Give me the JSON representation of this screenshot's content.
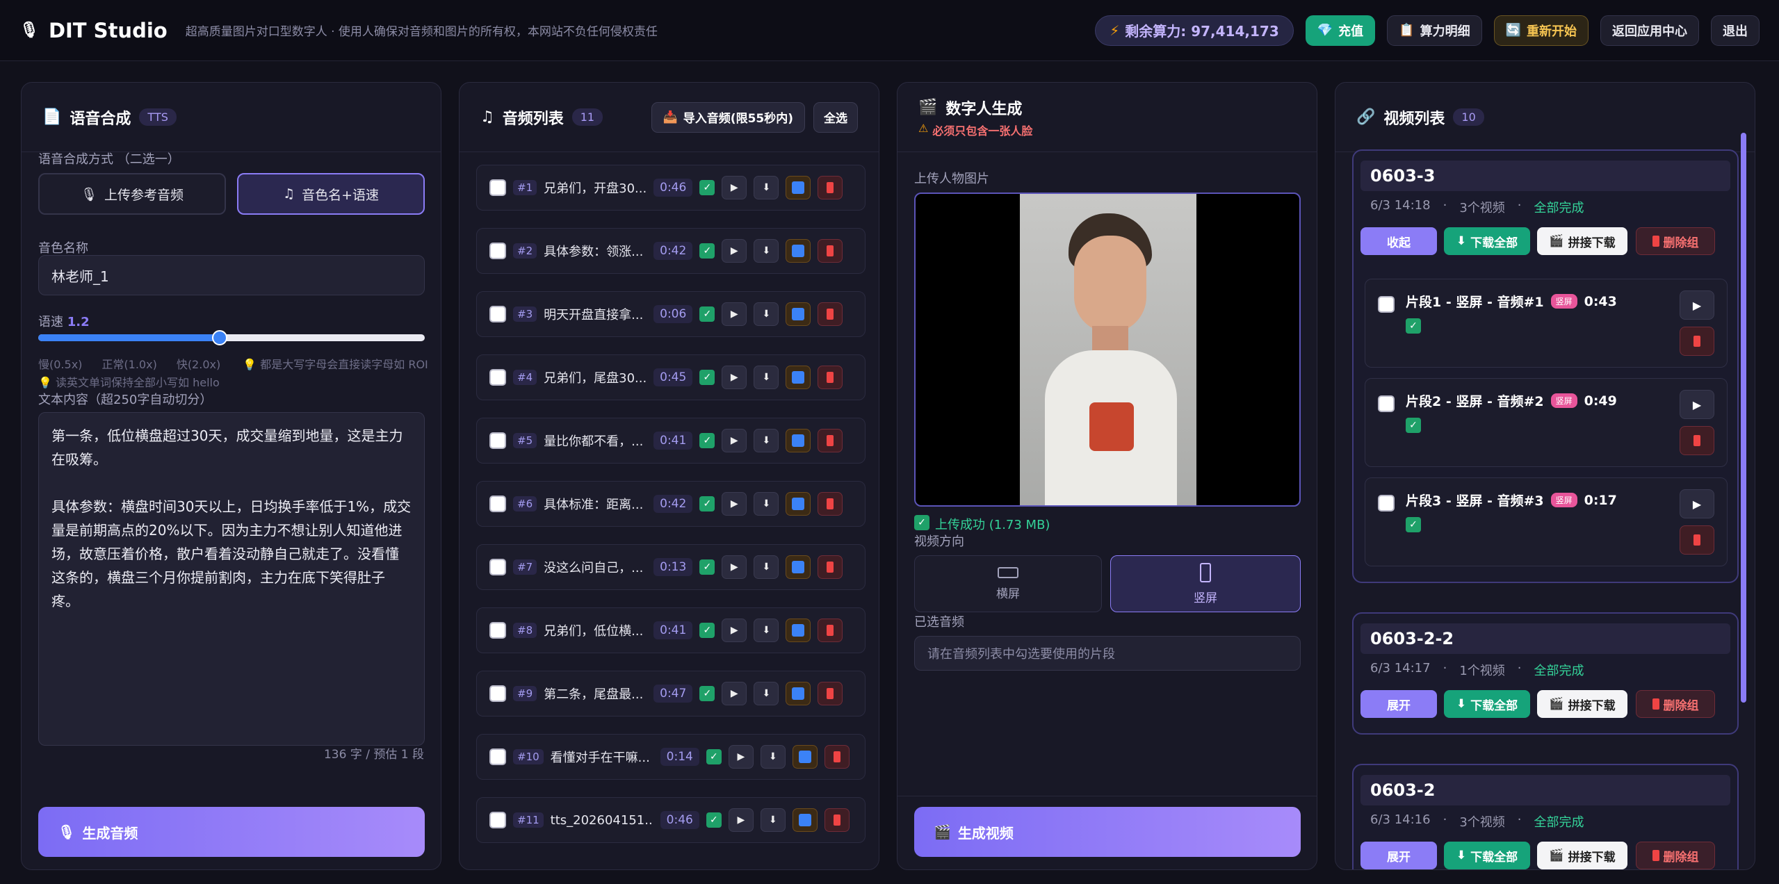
{
  "header": {
    "app_name": "DIT Studio",
    "tagline": "超高质量图片对口型数字人 · 使用人确保对音频和图片的所有权，本网站不负任何侵权责任",
    "credits_label": "剩余算力: 97,414,173",
    "recharge": "充值",
    "billing": "算力明细",
    "restart": "重新开始",
    "back": "返回应用中心",
    "logout": "退出"
  },
  "tts": {
    "title": "语音合成",
    "badge": "TTS",
    "mode_label": "语音合成方式 （二选一）",
    "mode_upload": "上传参考音频",
    "mode_voice": "音色名+语速",
    "voice_label": "音色名称",
    "voice_value": "林老师_1",
    "speed_label": "语速",
    "speed_value": "1.2",
    "speed_fraction": 0.47,
    "slow": "慢(0.5x)",
    "normal": "正常(1.0x)",
    "fast": "快(2.0x)",
    "hint1": "都是大写字母会直接读字母如 ROI",
    "hint2": "读英文单词保持全部小写如 hello",
    "text_label": "文本内容（超250字自动切分）",
    "text_value": "第一条，低位横盘超过30天，成交量缩到地量，这是主力在吸筹。\n\n具体参数：横盘时间30天以上，日均换手率低于1%，成交量是前期高点的20%以下。因为主力不想让别人知道他进场，故意压着价格，散户看着没动静自己就走了。没看懂这条的，横盘三个月你提前割肉，主力在底下笑得肚子疼。",
    "counter": "136 字 / 预估 1 段",
    "generate": "生成音频"
  },
  "audio": {
    "title": "音频列表",
    "count": "11",
    "import": "导入音频(限55秒内)",
    "select_all": "全选",
    "items": [
      {
        "n": "#1",
        "t": "兄弟们，开盘30...",
        "d": "0:46"
      },
      {
        "n": "#2",
        "t": "具体参数：领涨...",
        "d": "0:42"
      },
      {
        "n": "#3",
        "t": "明天开盘直接拿...",
        "d": "0:06"
      },
      {
        "n": "#4",
        "t": "兄弟们，尾盘30...",
        "d": "0:45"
      },
      {
        "n": "#5",
        "t": "量比你都不看，...",
        "d": "0:41"
      },
      {
        "n": "#6",
        "t": "具体标准：距离...",
        "d": "0:42"
      },
      {
        "n": "#7",
        "t": "没这么问自己，...",
        "d": "0:13"
      },
      {
        "n": "#8",
        "t": "兄弟们，低位横...",
        "d": "0:41"
      },
      {
        "n": "#9",
        "t": "第二条，尾盘最...",
        "d": "0:47"
      },
      {
        "n": "#10",
        "t": "看懂对手在干嘛...",
        "d": "0:14"
      },
      {
        "n": "#11",
        "t": "tts_202604151...",
        "d": "0:46"
      }
    ]
  },
  "avatar": {
    "title": "数字人生成",
    "warning": "必须只包含一张人脸",
    "upload_label": "上传人物图片",
    "upload_ok": "上传成功 (1.73 MB)",
    "orient_label": "视频方向",
    "landscape": "横屏",
    "portrait": "竖屏",
    "selected_label": "已选音频",
    "selected_placeholder": "请在音频列表中勾选要使用的片段",
    "generate": "生成视频"
  },
  "videos": {
    "title": "视频列表",
    "count": "10",
    "groups": [
      {
        "name": "0603-3",
        "date": "6/3 14:18",
        "videos": "3个视频",
        "status": "全部完成",
        "toggle": "收起",
        "dl": "下载全部",
        "merge": "拼接下载",
        "del": "删除组",
        "segs": [
          {
            "t": "片段1 - 竖屏 - 音频#1",
            "tag": "竖屏",
            "d": "0:43"
          },
          {
            "t": "片段2 - 竖屏 - 音频#2",
            "tag": "竖屏",
            "d": "0:49"
          },
          {
            "t": "片段3 - 竖屏 - 音频#3",
            "tag": "竖屏",
            "d": "0:17"
          }
        ]
      },
      {
        "name": "0603-2-2",
        "date": "6/3 14:17",
        "videos": "1个视频",
        "status": "全部完成",
        "toggle": "展开",
        "dl": "下载全部",
        "merge": "拼接下载",
        "del": "删除组"
      },
      {
        "name": "0603-2",
        "date": "6/3 14:16",
        "videos": "3个视频",
        "status": "全部完成",
        "toggle": "展开",
        "dl": "下载全部",
        "merge": "拼接下载",
        "del": "删除组"
      }
    ]
  },
  "colors": {
    "accent": "#8b7cf6",
    "green": "#16a37a",
    "danger": "#ef4444",
    "bg": "#11111b"
  }
}
